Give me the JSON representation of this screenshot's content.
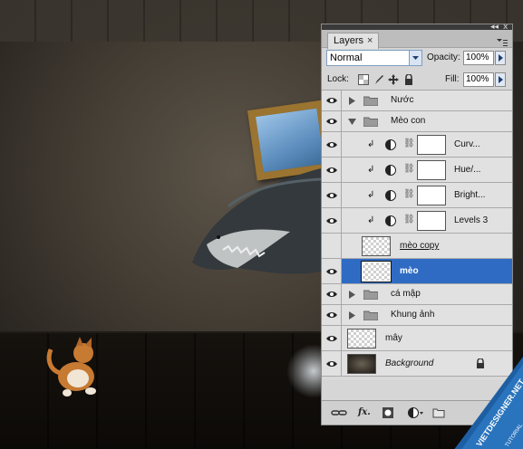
{
  "panel": {
    "tab_label": "Layers",
    "tab_close": "×",
    "blend_mode": "Normal",
    "opacity_label": "Opacity:",
    "opacity_value": "100%",
    "lock_label": "Lock:",
    "fill_label": "Fill:",
    "fill_value": "100%"
  },
  "layers": [
    {
      "name": "Nước",
      "kind": "group",
      "expanded": false
    },
    {
      "name": "Mèo con",
      "kind": "group",
      "expanded": true
    },
    {
      "name": "Curv...",
      "kind": "adjustment"
    },
    {
      "name": "Hue/...",
      "kind": "adjustment"
    },
    {
      "name": "Bright...",
      "kind": "adjustment"
    },
    {
      "name": "Levels 3",
      "kind": "adjustment"
    },
    {
      "name": "mèo copy",
      "kind": "pixel",
      "selected": false
    },
    {
      "name": "mèo",
      "kind": "pixel",
      "selected": true
    },
    {
      "name": "cá mập",
      "kind": "group",
      "expanded": false
    },
    {
      "name": "Khung ảnh",
      "kind": "group",
      "expanded": false
    },
    {
      "name": "mây",
      "kind": "pixel"
    },
    {
      "name": "Background",
      "kind": "background",
      "locked": true
    }
  ],
  "footer_icons": [
    "link-icon",
    "fx-icon",
    "mask-icon",
    "adjustment-icon",
    "folder-icon"
  ],
  "footer": {
    "fx_label": "fx."
  },
  "watermark": {
    "line1": "VIETDESIGNER.NET",
    "line2": "TUTORIAL"
  },
  "colors": {
    "selection": "#2f6bc3",
    "panel": "#d6d6d6"
  }
}
